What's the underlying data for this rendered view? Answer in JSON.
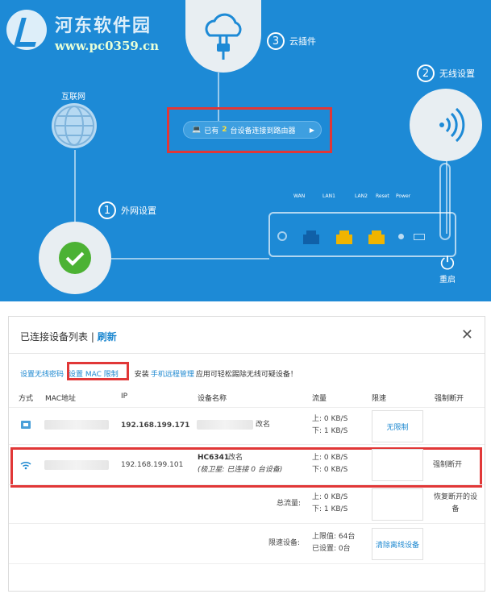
{
  "watermark": {
    "title": "河东软件园",
    "url": "www.pc0359.cn"
  },
  "router_panel": {
    "internet_label": "互联网",
    "steps": [
      {
        "num": "1",
        "label": "外网设置"
      },
      {
        "num": "2",
        "label": "无线设置"
      },
      {
        "num": "3",
        "label": "云插件"
      }
    ],
    "status": {
      "prefix": "已有",
      "count": "2",
      "suffix": "台设备连接到路由器"
    },
    "ports": [
      "WAN",
      "LAN1",
      "LAN2",
      "Reset",
      "Power"
    ],
    "reboot_label": "重启",
    "colors": {
      "background": "#1d8ad6",
      "wan_port": "#1060a8",
      "lan_port": "#f0b400",
      "highlight": "#e13737"
    }
  },
  "device_panel": {
    "title": "已连接设备列表",
    "separator": " | ",
    "refresh": "刷新",
    "close": "✕",
    "toolbar": {
      "wifi_pwd": "设置无线密码",
      "mac_limit": "设置 MAC 限制",
      "install_prefix": "安装",
      "remote_app": "手机远程管理",
      "install_suffix": "应用可轻松踢除无线可疑设备！"
    },
    "columns": [
      "方式",
      "MAC地址",
      "IP",
      "设备名称",
      "流量",
      "限速",
      "强制断开"
    ],
    "rows": [
      {
        "type_icon": "lan-icon",
        "ip": "192.168.199.171",
        "name": "",
        "rename": "改名",
        "up": "上: 0 KB/S",
        "down": "下: 1 KB/S",
        "limit": "无限制",
        "action": ""
      },
      {
        "type_icon": "wifi-icon",
        "ip": "192.168.199.101",
        "name": "HC6341",
        "rename": "改名",
        "sub": "(极卫星: 已连接 0 台设备)",
        "up": "上: 0 KB/S",
        "down": "下: 0 KB/S",
        "limit": "",
        "action": "强制断开"
      }
    ],
    "total": {
      "label": "总流量:",
      "up": "上: 0 KB/S",
      "down": "下: 1 KB/S",
      "restore": "恢复断开的设备"
    },
    "limited": {
      "label": "限速设备:",
      "max": "上限值: 64台",
      "set": "已设置: 0台",
      "clear": "清除离线设备"
    }
  }
}
